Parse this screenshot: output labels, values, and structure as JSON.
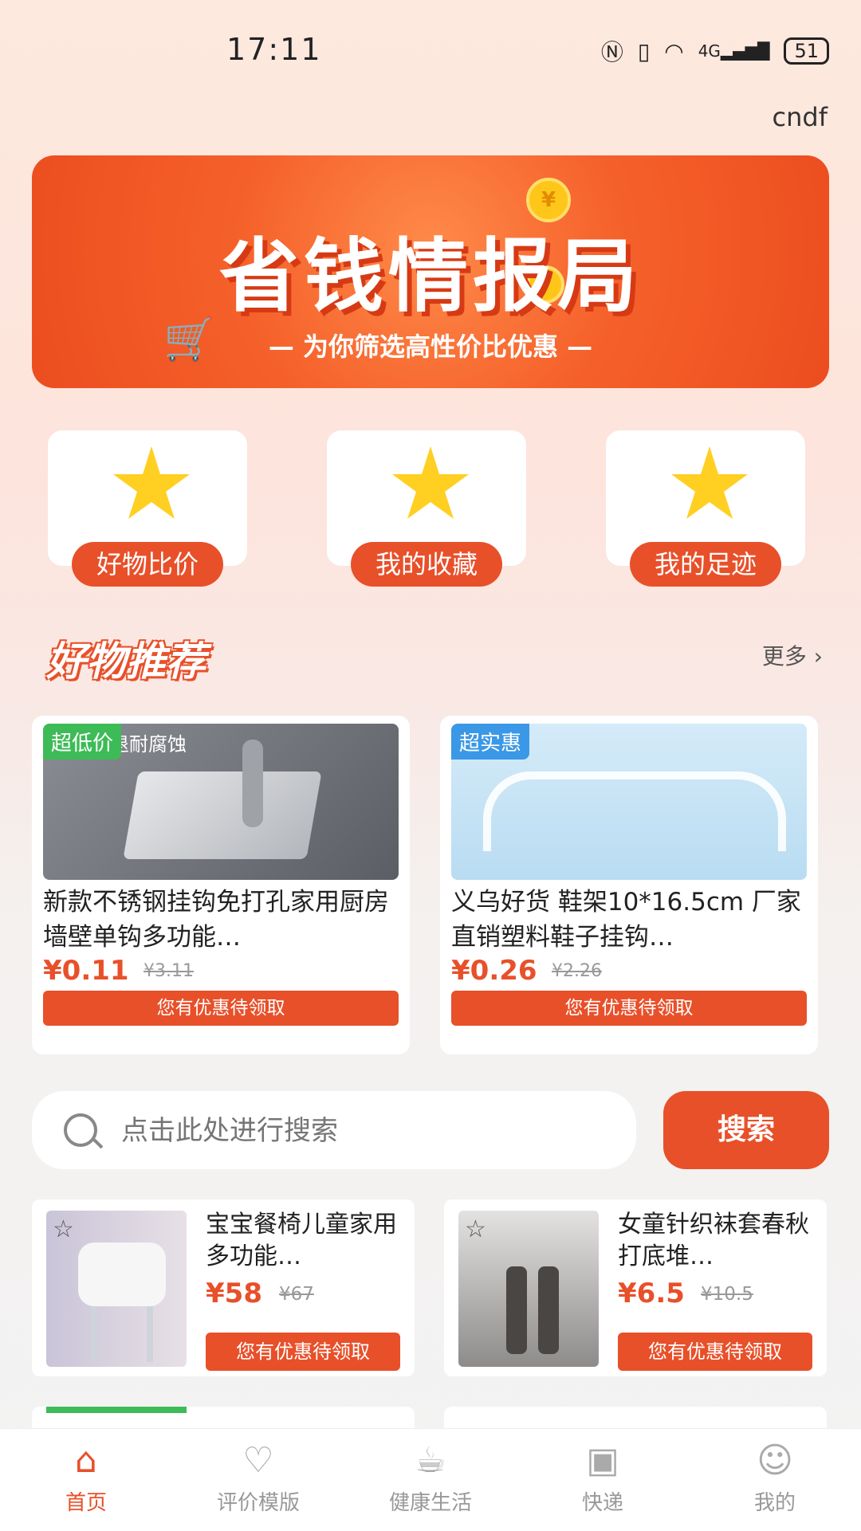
{
  "status": {
    "time": "17:11",
    "battery": "51",
    "signal_label": "4G"
  },
  "user": {
    "name": "cndf"
  },
  "banner": {
    "title": "省钱情报局",
    "subtitle": "— 为你筛选高性价比优惠 —"
  },
  "tiles": [
    {
      "label": "好物比价"
    },
    {
      "label": "我的收藏"
    },
    {
      "label": "我的足迹"
    }
  ],
  "section": {
    "title": "好物推荐",
    "more": "更多 ›"
  },
  "featured": [
    {
      "tag": "超低价",
      "image_text": "包退耐腐蚀",
      "name": "新款不锈钢挂钩免打孔家用厨房墙壁单钩多功能…",
      "price": "¥0.11",
      "old_price": "¥3.11",
      "button": "您有优惠待领取"
    },
    {
      "tag": "超实惠",
      "image_text": "",
      "name": "义乌好货 鞋架10*16.5cm 厂家直销塑料鞋子挂钩…",
      "price": "¥0.26",
      "old_price": "¥2.26",
      "button": "您有优惠待领取"
    }
  ],
  "search": {
    "placeholder": "点击此处进行搜索",
    "button": "搜索"
  },
  "items": [
    {
      "name": "宝宝餐椅儿童家用多功能…",
      "price": "¥58",
      "old_price": "¥67",
      "button": "您有优惠待领取"
    },
    {
      "name": "女童针织袜套春秋打底堆…",
      "price": "¥6.5",
      "old_price": "¥10.5",
      "button": "您有优惠待领取"
    }
  ],
  "nav": [
    {
      "label": "首页",
      "icon": "home-icon",
      "active": true
    },
    {
      "label": "评价模版",
      "icon": "review-icon",
      "active": false
    },
    {
      "label": "健康生活",
      "icon": "cup-icon",
      "active": false
    },
    {
      "label": "快递",
      "icon": "package-icon",
      "active": false
    },
    {
      "label": "我的",
      "icon": "profile-icon",
      "active": false
    }
  ],
  "colors": {
    "accent": "#e8502a",
    "tag_green": "#3dbb57",
    "tag_blue": "#3a98e6"
  }
}
